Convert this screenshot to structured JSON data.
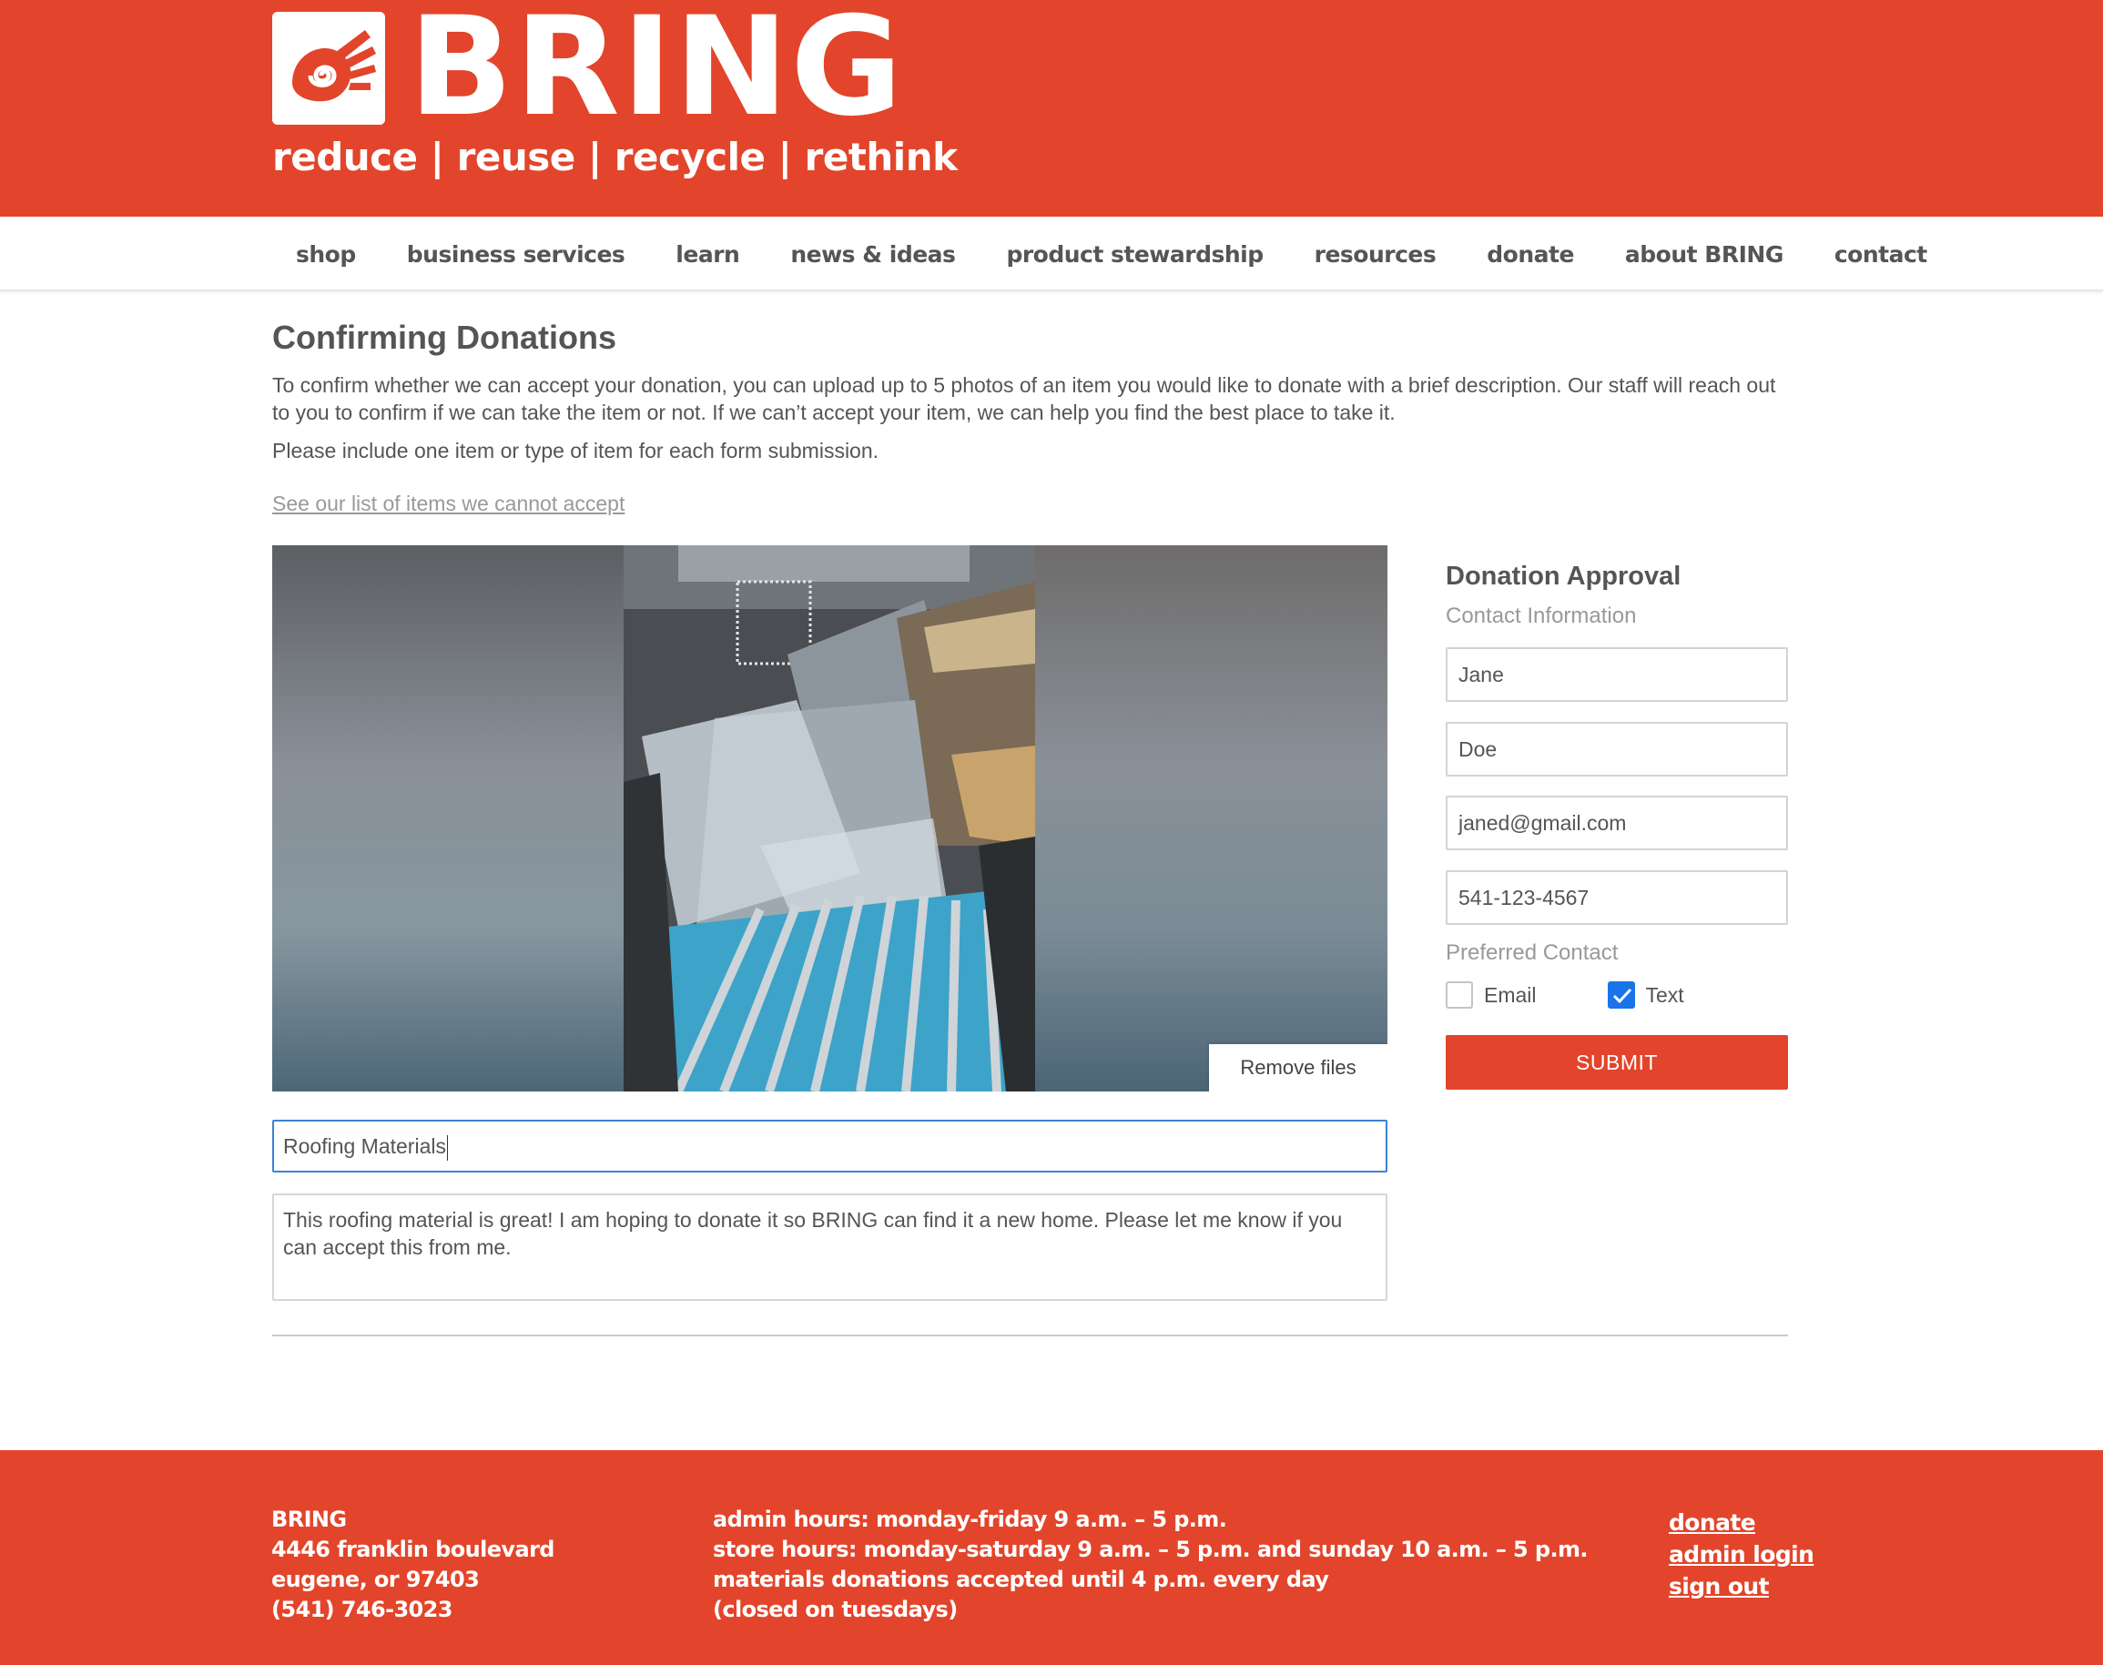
{
  "brand": {
    "name": "BRING",
    "tagline": "reduce | reuse | recycle | rethink",
    "colors": {
      "primary": "#e2452b",
      "accent_blue": "#1a73e8"
    }
  },
  "nav": {
    "items": [
      "shop",
      "business services",
      "learn",
      "news & ideas",
      "product stewardship",
      "resources",
      "donate",
      "about BRING",
      "contact"
    ]
  },
  "main": {
    "title": "Confirming Donations",
    "intro": "To confirm whether we can accept your donation, you can upload up to 5 photos of an item you would like to donate with a brief description. Our staff will reach out to you to confirm if we can take the item or not. If we can’t accept your item, we can help you find the best place to take it.",
    "note": "Please include one item or type of item for each form submission.",
    "cannot_accept_link": "See our list of items we cannot accept",
    "remove_files_label": "Remove files",
    "item_title_value": "Roofing Materials",
    "description_value": "This roofing material is great! I am hoping to donate it so BRING can find it a new home. Please let me know if you can accept this from me."
  },
  "form": {
    "title": "Donation Approval",
    "contact_heading": "Contact Information",
    "first_name": "Jane",
    "last_name": "Doe",
    "email": "janed@gmail.com",
    "phone": "541-123-4567",
    "preferred_heading": "Preferred Contact",
    "options": [
      {
        "label": "Email",
        "checked": false
      },
      {
        "label": "Text",
        "checked": true
      }
    ],
    "submit_label": "SUBMIT"
  },
  "footer": {
    "org": "BRING",
    "address1": "4446 franklin boulevard",
    "address2": "eugene, or 97403",
    "phone": "(541) 746-3023",
    "admin_hours": "admin hours: monday-friday 9 a.m. – 5 p.m.",
    "store_hours": "store hours: monday-saturday 9 a.m. – 5 p.m. and sunday 10 a.m. – 5 p.m.",
    "materials_note": "materials donations accepted until 4 p.m. every day",
    "closed_note": "(closed on tuesdays)",
    "links": [
      "donate",
      "admin login",
      "sign out"
    ]
  }
}
